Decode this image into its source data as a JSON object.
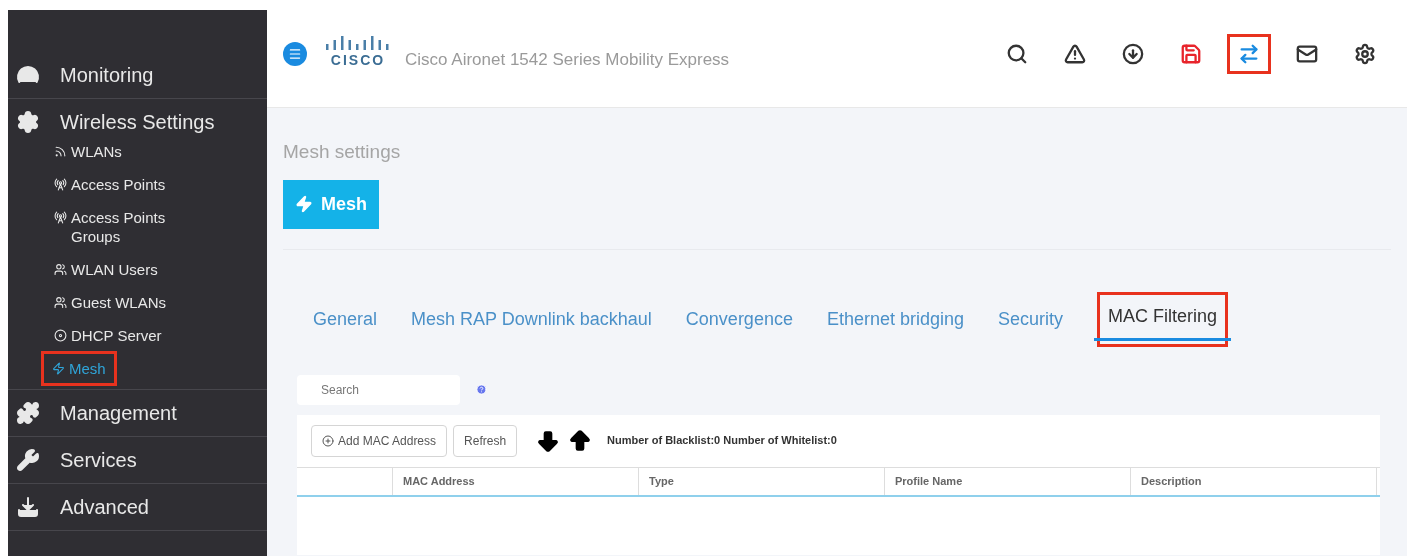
{
  "sidebar": {
    "items": [
      {
        "label": "Monitoring"
      },
      {
        "label": "Wireless Settings",
        "children": [
          {
            "label": "WLANs",
            "selected": false,
            "highlighted": false
          },
          {
            "label": "Access Points",
            "selected": false,
            "highlighted": false
          },
          {
            "label": "Access Points Groups",
            "selected": false,
            "highlighted": false
          },
          {
            "label": "WLAN Users",
            "selected": false,
            "highlighted": false
          },
          {
            "label": "Guest WLANs",
            "selected": false,
            "highlighted": false
          },
          {
            "label": "DHCP Server",
            "selected": false,
            "highlighted": false
          },
          {
            "label": "Mesh",
            "selected": true,
            "highlighted": true
          }
        ]
      },
      {
        "label": "Management"
      },
      {
        "label": "Services"
      },
      {
        "label": "Advanced"
      }
    ]
  },
  "header": {
    "logo_text": "CISCO",
    "product": "Cisco Aironet 1542 Series Mobility Express",
    "icons": [
      {
        "kind": "search",
        "highlighted": false
      },
      {
        "kind": "alert",
        "highlighted": false
      },
      {
        "kind": "download",
        "highlighted": false
      },
      {
        "kind": "save",
        "highlighted": false
      },
      {
        "kind": "transfer",
        "highlighted": true
      },
      {
        "kind": "mail",
        "highlighted": false
      },
      {
        "kind": "gear",
        "highlighted": false
      }
    ]
  },
  "page_title": "Mesh settings",
  "section_button": "Mesh",
  "tabs": [
    {
      "label": "General",
      "selected": false,
      "highlighted": false
    },
    {
      "label": "Mesh RAP Downlink backhaul",
      "selected": false,
      "highlighted": false
    },
    {
      "label": "Convergence",
      "selected": false,
      "highlighted": false
    },
    {
      "label": "Ethernet bridging",
      "selected": false,
      "highlighted": false
    },
    {
      "label": "Security",
      "selected": false,
      "highlighted": false
    },
    {
      "label": "MAC Filtering",
      "selected": true,
      "highlighted": true
    }
  ],
  "search": {
    "placeholder": "Search"
  },
  "toolbar": {
    "add_button": "Add MAC Address",
    "refresh_button": "Refresh",
    "counts": "Number of Blacklist:0 Number of Whitelist:0"
  },
  "table": {
    "columns": [
      "MAC Address",
      "Type",
      "Profile Name",
      "Description"
    ]
  }
}
